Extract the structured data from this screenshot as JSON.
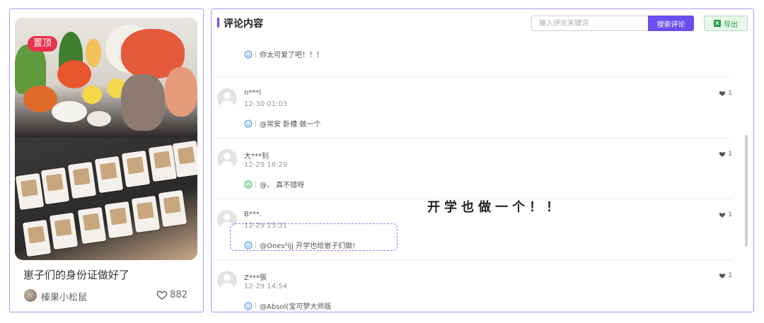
{
  "post": {
    "badge": "置顶",
    "title": "崽子们的身份证做好了",
    "author": "榛果小松鼠",
    "likes": "882"
  },
  "panel": {
    "title": "评论内容",
    "search_placeholder": "输入评论关键词",
    "search_button": "搜索评论",
    "export_button": "导出",
    "excel_icon_letter": "X"
  },
  "comments": [
    {
      "text": "你太可爱了吧！！！",
      "icon": "smile-face-icon"
    },
    {
      "user": "n***l",
      "time": "12-30 01:03",
      "likes": "1",
      "text": "@常安 卧槽 做一个",
      "icon": "smile-face-icon"
    },
    {
      "user": "大***钊",
      "time": "12-29 16:29",
      "likes": "1",
      "text": "@、 真不错呀",
      "icon": "green-smile-face-icon"
    },
    {
      "user": "B***.",
      "time": "12-29 15:31",
      "likes": "1",
      "text": "@Ones²ljj 开学也给崽子们做!",
      "icon": "smile-face-icon"
    },
    {
      "user": "Z***張",
      "time": "12-29 14:54",
      "likes": "1",
      "text": "@Absol(宝可梦大师版",
      "icon": "smile-face-icon"
    }
  ],
  "overlay": {
    "text": "开学也做一个！！"
  },
  "colors": {
    "accent": "#6b4ef0",
    "badge": "#e8334a",
    "export_green": "#2f9e44"
  }
}
